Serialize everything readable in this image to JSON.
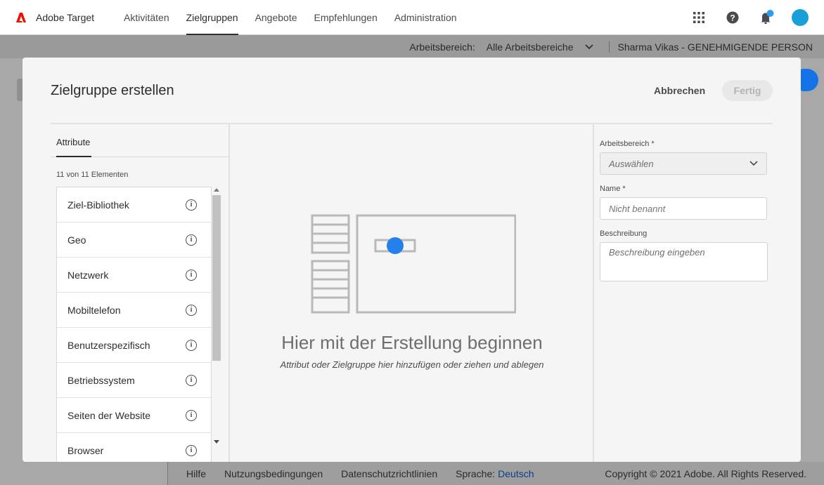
{
  "topnav": {
    "brand": "Adobe Target",
    "items": [
      {
        "label": "Aktivitäten"
      },
      {
        "label": "Zielgruppen"
      },
      {
        "label": "Angebote"
      },
      {
        "label": "Empfehlungen"
      },
      {
        "label": "Administration"
      }
    ],
    "active_item": "Zielgruppen",
    "icons": [
      "apps-grid-icon",
      "help-icon",
      "notifications-bell-icon",
      "user-avatar"
    ]
  },
  "subbar": {
    "workspace_label": "Arbeitsbereich:",
    "workspace_value": "Alle Arbeitsbereiche",
    "user": "Sharma Vikas - GENEHMIGENDE PERSON"
  },
  "footer": {
    "help": "Hilfe",
    "terms": "Nutzungsbedingungen",
    "privacy": "Datenschutzrichtlinien",
    "language_label": "Sprache:",
    "language_value": "Deutsch",
    "copyright": "Copyright © 2021 Adobe. All Rights Reserved."
  },
  "modal": {
    "title": "Zielgruppe erstellen",
    "cancel_label": "Abbrechen",
    "done_label": "Fertig",
    "left": {
      "tab_label": "Attribute",
      "count_text": "11 von 11 Elementen",
      "items": [
        {
          "label": "Ziel-Bibliothek"
        },
        {
          "label": "Geo"
        },
        {
          "label": "Netzwerk"
        },
        {
          "label": "Mobiltelefon"
        },
        {
          "label": "Benutzerspezifisch"
        },
        {
          "label": "Betriebssystem"
        },
        {
          "label": "Seiten der Website"
        },
        {
          "label": "Browser"
        }
      ]
    },
    "center": {
      "title": "Hier mit der Erstellung beginnen",
      "subtitle": "Attribut oder Zielgruppe hier hinzufügen oder ziehen und ablegen"
    },
    "right": {
      "workspace_label": "Arbeitsbereich *",
      "workspace_placeholder": "Auswählen",
      "name_label": "Name *",
      "name_placeholder": "Nicht benannt",
      "description_label": "Beschreibung",
      "description_placeholder": "Beschreibung eingeben"
    }
  },
  "colors": {
    "brand_red": "#eb1000",
    "accent_blue": "#1473e6",
    "notification_dot": "#2d9cf0",
    "avatar": "#1aa0d8"
  }
}
